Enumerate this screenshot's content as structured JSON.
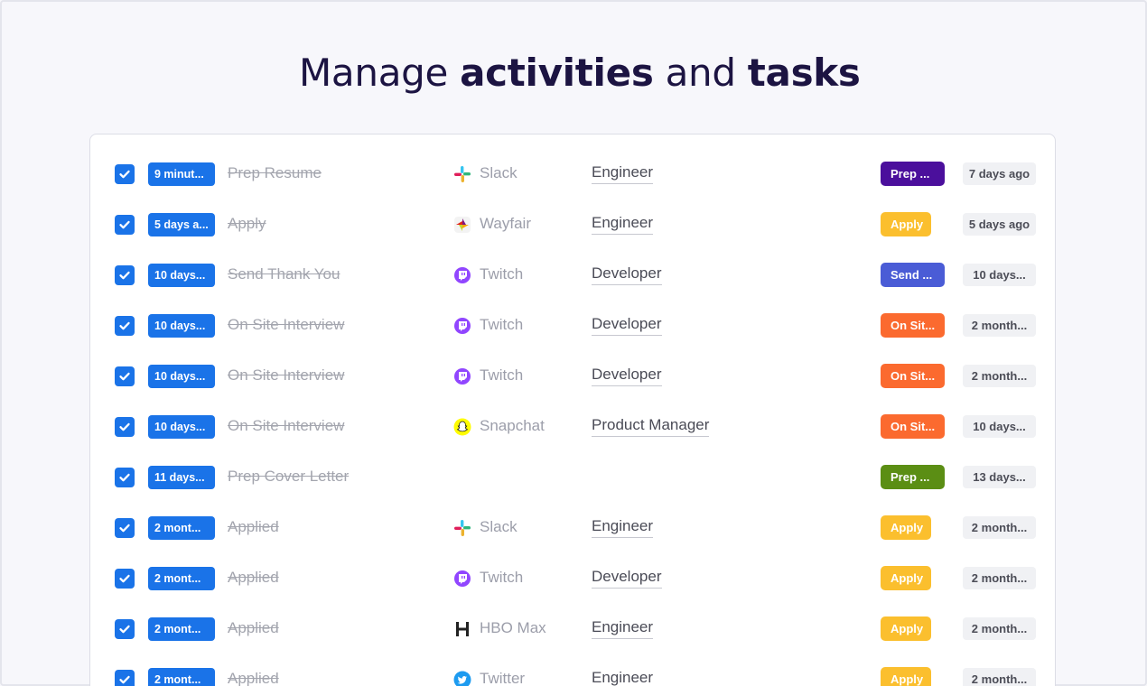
{
  "headline": {
    "prefix": "Manage ",
    "bold1": "activities",
    "middle": " and ",
    "bold2": "tasks"
  },
  "colors": {
    "check": "#1a73e8",
    "time_chip": "#1a73e8",
    "stage_prep_purple": "#4b0f9c",
    "stage_apply": "#fbbf2e",
    "stage_send": "#4a5cd6",
    "stage_onsite": "#fb6a2f",
    "stage_prep_green": "#5b8e14"
  },
  "rows": [
    {
      "checked": true,
      "time": "9 minut...",
      "task": "Prep Resume",
      "company": "Slack",
      "logo": "slack-icon",
      "role": "Engineer",
      "stage": "Prep ...",
      "stage_color": "#4b0f9c",
      "ago": "7 days ago"
    },
    {
      "checked": true,
      "time": "5 days a...",
      "task": "Apply",
      "company": "Wayfair",
      "logo": "wayfair-icon",
      "role": "Engineer",
      "stage": "Apply",
      "stage_color": "#fbbf2e",
      "ago": "5 days ago"
    },
    {
      "checked": true,
      "time": "10 days...",
      "task": "Send Thank You",
      "company": "Twitch",
      "logo": "twitch-icon",
      "role": "Developer",
      "stage": "Send ...",
      "stage_color": "#4a5cd6",
      "ago": "10 days..."
    },
    {
      "checked": true,
      "time": "10 days...",
      "task": "On Site Interview",
      "company": "Twitch",
      "logo": "twitch-icon",
      "role": "Developer",
      "stage": "On Sit...",
      "stage_color": "#fb6a2f",
      "ago": "2 month..."
    },
    {
      "checked": true,
      "time": "10 days...",
      "task": "On Site Interview",
      "company": "Twitch",
      "logo": "twitch-icon",
      "role": "Developer",
      "stage": "On Sit...",
      "stage_color": "#fb6a2f",
      "ago": "2 month..."
    },
    {
      "checked": true,
      "time": "10 days...",
      "task": "On Site Interview",
      "company": "Snapchat",
      "logo": "snapchat-icon",
      "role": "Product Manager",
      "stage": "On Sit...",
      "stage_color": "#fb6a2f",
      "ago": "10 days..."
    },
    {
      "checked": true,
      "time": "11 days...",
      "task": "Prep Cover Letter",
      "company": "",
      "logo": "",
      "role": "",
      "stage": "Prep ...",
      "stage_color": "#5b8e14",
      "ago": "13 days..."
    },
    {
      "checked": true,
      "time": "2 mont...",
      "task": "Applied",
      "company": "Slack",
      "logo": "slack-icon",
      "role": "Engineer",
      "stage": "Apply",
      "stage_color": "#fbbf2e",
      "ago": "2 month..."
    },
    {
      "checked": true,
      "time": "2 mont...",
      "task": "Applied",
      "company": "Twitch",
      "logo": "twitch-icon",
      "role": "Developer",
      "stage": "Apply",
      "stage_color": "#fbbf2e",
      "ago": "2 month..."
    },
    {
      "checked": true,
      "time": "2 mont...",
      "task": "Applied",
      "company": "HBO Max",
      "logo": "hbo-max-icon",
      "role": "Engineer",
      "stage": "Apply",
      "stage_color": "#fbbf2e",
      "ago": "2 month..."
    },
    {
      "checked": true,
      "time": "2 mont...",
      "task": "Applied",
      "company": "Twitter",
      "logo": "twitter-icon",
      "role": "Engineer",
      "stage": "Apply",
      "stage_color": "#fbbf2e",
      "ago": "2 month..."
    }
  ]
}
